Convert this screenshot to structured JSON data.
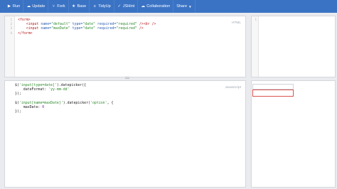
{
  "toolbar": {
    "run": "Run",
    "update": "Update",
    "fork": "Fork",
    "base": "Base",
    "tidyup": "TidyUp",
    "jshint": "JSHint",
    "collaboration": "Collaboration",
    "share": "Share"
  },
  "icons": {
    "run": "play-icon",
    "update": "cloud-upload-icon",
    "fork": "fork-icon",
    "base": "star-icon",
    "tidyup": "tidy-icon",
    "jshint": "check-icon",
    "collaboration": "collaboration-icon",
    "share": "caret-down-icon"
  },
  "panes": {
    "html_label": "HTML",
    "js_label": "JavaScript"
  },
  "html_code": [
    [
      {
        "t": "tag",
        "v": "<form>"
      }
    ],
    [
      {
        "t": "plain",
        "v": "    "
      },
      {
        "t": "tag",
        "v": "<input "
      },
      {
        "t": "attr",
        "v": "name="
      },
      {
        "t": "str",
        "v": "\"default\""
      },
      {
        "t": "attr",
        "v": " type="
      },
      {
        "t": "str",
        "v": "\"date\""
      },
      {
        "t": "attr",
        "v": " required="
      },
      {
        "t": "str",
        "v": "\"required\""
      },
      {
        "t": "tag",
        "v": " /><br />"
      }
    ],
    [
      {
        "t": "plain",
        "v": "    "
      },
      {
        "t": "tag",
        "v": "<input "
      },
      {
        "t": "attr",
        "v": "name="
      },
      {
        "t": "str",
        "v": "\"maxDate\""
      },
      {
        "t": "attr",
        "v": " type="
      },
      {
        "t": "str",
        "v": "\"date\""
      },
      {
        "t": "attr",
        "v": " required="
      },
      {
        "t": "str",
        "v": "\"required\""
      },
      {
        "t": "tag",
        "v": " />"
      }
    ],
    [
      {
        "t": "tag",
        "v": "</form>"
      }
    ]
  ],
  "js_code": [
    [
      {
        "t": "plain",
        "v": "$("
      },
      {
        "t": "str",
        "v": "'input[type=date]'"
      },
      {
        "t": "plain",
        "v": ").datepicker({"
      }
    ],
    [
      {
        "t": "plain",
        "v": "    dateFormat: "
      },
      {
        "t": "str",
        "v": "'yy-mm-dd'"
      }
    ],
    [
      {
        "t": "plain",
        "v": "});"
      }
    ],
    [
      {
        "t": "plain",
        "v": ""
      }
    ],
    [
      {
        "t": "plain",
        "v": "$("
      },
      {
        "t": "str",
        "v": "'input[name=maxDate]'"
      },
      {
        "t": "plain",
        "v": ").datepicker("
      },
      {
        "t": "str",
        "v": "'option'"
      },
      {
        "t": "plain",
        "v": ", {"
      }
    ],
    [
      {
        "t": "plain",
        "v": "    maxDate: "
      },
      {
        "t": "num",
        "v": "0"
      }
    ],
    [
      {
        "t": "plain",
        "v": "});"
      }
    ]
  ],
  "html_line_numbers": [
    "1",
    "2",
    "3",
    "4"
  ],
  "result_gutter": "1"
}
